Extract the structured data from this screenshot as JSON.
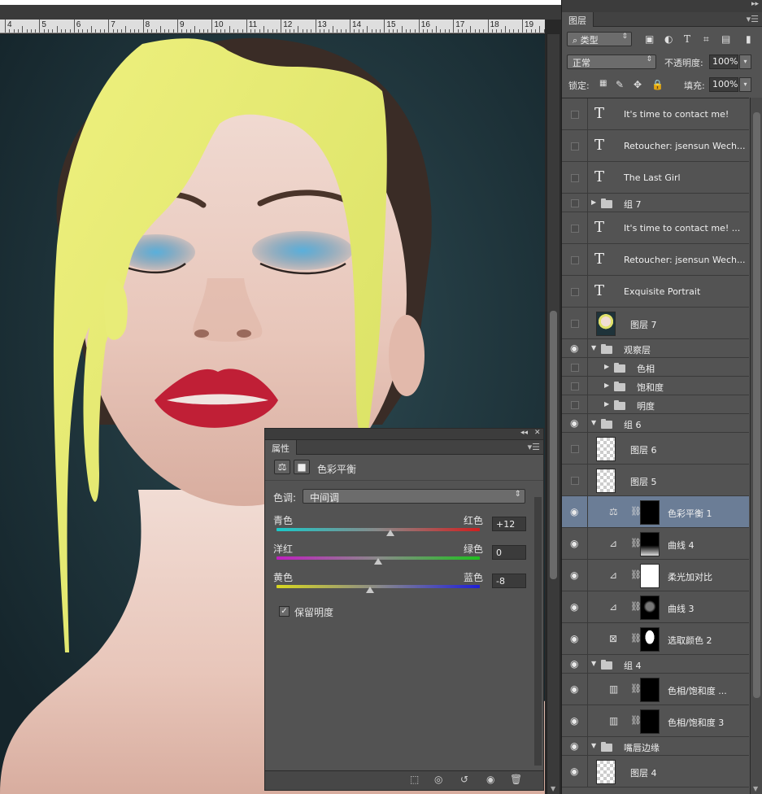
{
  "ruler": {
    "numbers": [
      "4",
      "5",
      "6",
      "7",
      "8",
      "9",
      "10",
      "11",
      "12",
      "13",
      "14",
      "15",
      "16",
      "17",
      "18",
      "19"
    ]
  },
  "properties": {
    "tab_label": "属性",
    "title": "色彩平衡",
    "tone_label": "色调:",
    "tone_value": "中间调",
    "sliders": [
      {
        "left": "青色",
        "right": "红色",
        "value": "+12",
        "level": 12
      },
      {
        "left": "洋红",
        "right": "绿色",
        "value": "0",
        "level": 0
      },
      {
        "left": "黄色",
        "right": "蓝色",
        "value": "-8",
        "level": -8
      }
    ],
    "preserve_label": "保留明度",
    "preserve_checked": "✓"
  },
  "layers": {
    "tab_label": "图层",
    "filter_label": "类型",
    "blend_mode": "正常",
    "opacity_label": "不透明度:",
    "opacity_value": "100%",
    "lock_label": "锁定:",
    "fill_label": "填充:",
    "fill_value": "100%",
    "rows": [
      {
        "kind": "text",
        "label": "It's time to contact me!",
        "visible": false,
        "h": 39
      },
      {
        "kind": "text",
        "label": "Retoucher: jsensun Wech...",
        "visible": false,
        "h": 39
      },
      {
        "kind": "text",
        "label": "The Last Girl",
        "visible": false,
        "h": 39
      },
      {
        "kind": "group",
        "label": "组 7",
        "visible": false,
        "h": 23,
        "indent": 0,
        "open": false
      },
      {
        "kind": "text",
        "label": "It's time to contact me! ...",
        "visible": false,
        "h": 39
      },
      {
        "kind": "text",
        "label": "Retoucher: jsensun Wech...",
        "visible": false,
        "h": 39
      },
      {
        "kind": "text",
        "label": "Exquisite Portrait",
        "visible": false,
        "h": 39
      },
      {
        "kind": "image",
        "label": "图层 7",
        "visible": false,
        "h": 39,
        "thumb": "portrait"
      },
      {
        "kind": "group",
        "label": "观察层",
        "visible": true,
        "h": 23,
        "indent": 0,
        "open": true
      },
      {
        "kind": "group",
        "label": "色相",
        "visible": false,
        "h": 23,
        "indent": 1,
        "open": false
      },
      {
        "kind": "group",
        "label": "饱和度",
        "visible": false,
        "h": 23,
        "indent": 1,
        "open": false
      },
      {
        "kind": "group",
        "label": "明度",
        "visible": false,
        "h": 23,
        "indent": 1,
        "open": false
      },
      {
        "kind": "group",
        "label": "组 6",
        "visible": true,
        "h": 23,
        "indent": 0,
        "open": true
      },
      {
        "kind": "image",
        "label": "图层 6",
        "visible": false,
        "h": 39,
        "thumb": "checker"
      },
      {
        "kind": "image",
        "label": "图层 5",
        "visible": false,
        "h": 39,
        "thumb": "checker"
      },
      {
        "kind": "adjust",
        "label": "色彩平衡 1",
        "visible": true,
        "h": 39,
        "icon": "⚖",
        "mask": "black",
        "selected": true
      },
      {
        "kind": "adjust",
        "label": "曲线 4",
        "visible": true,
        "h": 39,
        "icon": "⊿",
        "mask": "gradient"
      },
      {
        "kind": "adjust",
        "label": "柔光加对比",
        "visible": true,
        "h": 39,
        "icon": "⊿",
        "mask": "white"
      },
      {
        "kind": "adjust",
        "label": "曲线 3",
        "visible": true,
        "h": 39,
        "icon": "⊿",
        "mask": "face"
      },
      {
        "kind": "adjust",
        "label": "选取颜色 2",
        "visible": true,
        "h": 39,
        "icon": "⊠",
        "mask": "silhouette"
      },
      {
        "kind": "group",
        "label": "组 4",
        "visible": true,
        "h": 23,
        "indent": 0,
        "open": true
      },
      {
        "kind": "adjust",
        "label": "色相/饱和度 ...",
        "visible": true,
        "h": 39,
        "icon": "▥",
        "mask": "black"
      },
      {
        "kind": "adjust",
        "label": "色相/饱和度 3",
        "visible": true,
        "h": 39,
        "icon": "▥",
        "mask": "black"
      },
      {
        "kind": "group",
        "label": "嘴唇边缘",
        "visible": true,
        "h": 23,
        "indent": 0,
        "open": true
      },
      {
        "kind": "image",
        "label": "图层 4",
        "visible": true,
        "h": 39,
        "thumb": "checker"
      }
    ]
  },
  "colors": {
    "panel_bg": "#535353",
    "selected_row": "#6b7d96",
    "canvas_bg": "#20343c",
    "paint_yellow": "#e6ec79",
    "lip_red": "#c01f36",
    "eyeshadow_blue": "#4fa2cf"
  }
}
